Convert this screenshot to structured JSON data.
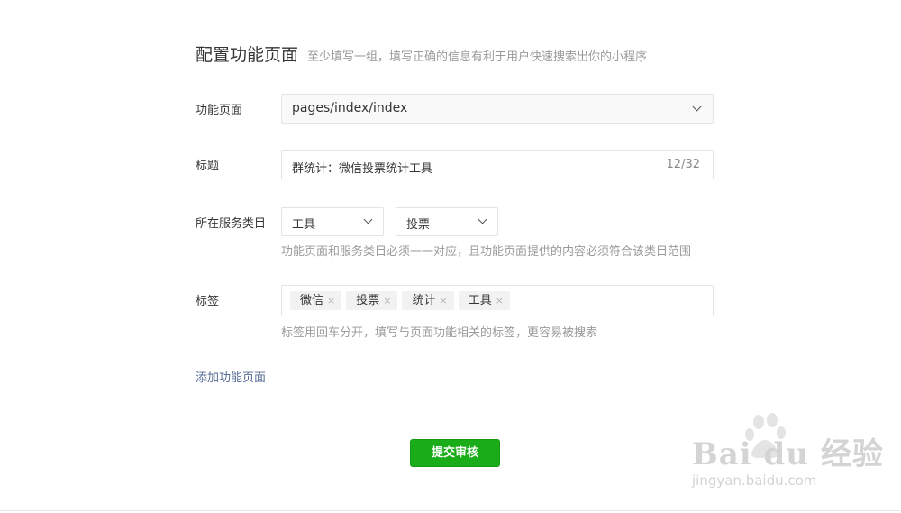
{
  "header": {
    "title": "配置功能页面",
    "subtitle": "至少填写一组，填写正确的信息有利于用户快速搜索出你的小程序"
  },
  "form": {
    "page_label": "功能页面",
    "page_value": "pages/index/index",
    "title_label": "标题",
    "title_value": "群统计：微信投票统计工具",
    "title_count": "12/32",
    "category_label": "所在服务类目",
    "category_1": "工具",
    "category_2": "投票",
    "category_hint": "功能页面和服务类目必须一一对应，且功能页面提供的内容必须符合该类目范围",
    "tags_label": "标签",
    "tags": [
      "微信",
      "投票",
      "统计",
      "工具"
    ],
    "tags_hint": "标签用回车分开，填写与页面功能相关的标签，更容易被搜索",
    "add_page_link": "添加功能页面"
  },
  "actions": {
    "submit_label": "提交审核"
  },
  "watermark": {
    "logo": "Bai du 经验",
    "url": "jingyan.baidu.com"
  },
  "colors": {
    "primary": "#1aad19",
    "link": "#576b95",
    "hint": "#9a9a9a"
  }
}
